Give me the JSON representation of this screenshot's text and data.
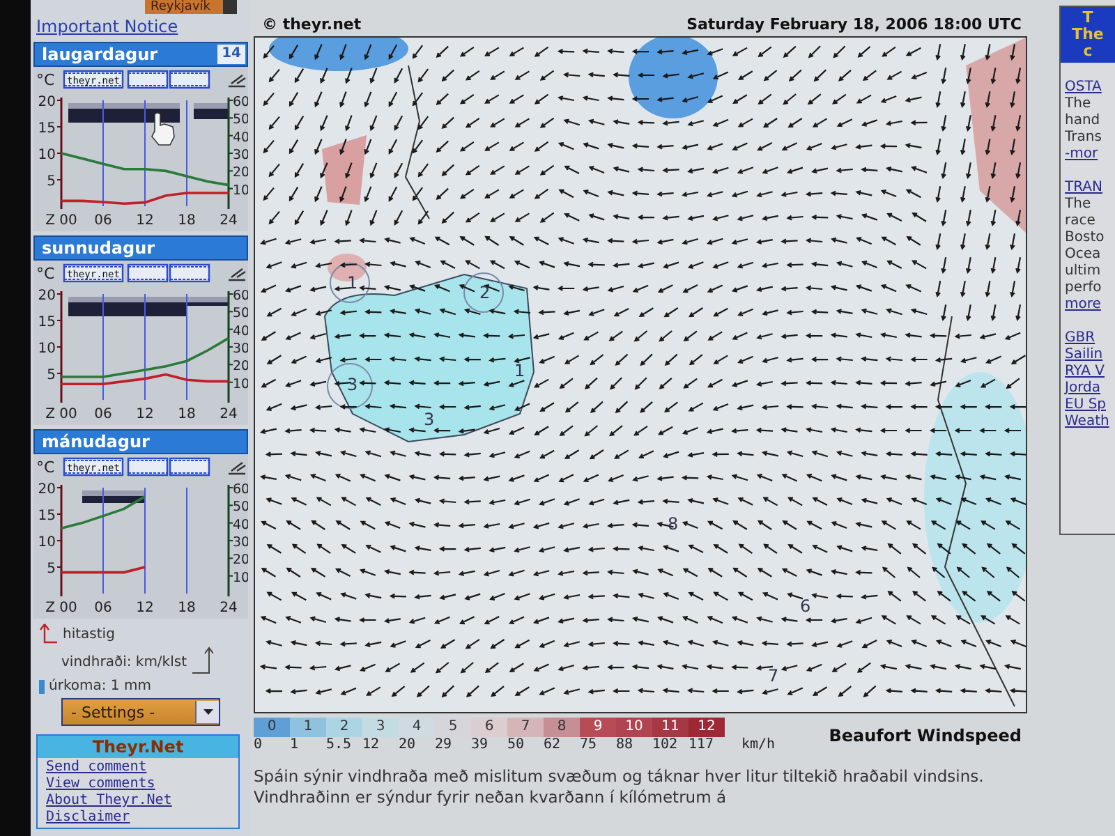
{
  "city_select": {
    "value": "Reykjavík"
  },
  "notice_link": "Important Notice",
  "days": [
    {
      "name": "laugardagur",
      "badge": "14",
      "unit": "°C",
      "logo_text": "theyr.net",
      "chart_data": {
        "type": "line",
        "grid": true,
        "x": [
          0,
          3,
          6,
          9,
          12,
          15,
          18,
          21,
          24
        ],
        "xlim": [
          0,
          24
        ],
        "xticks": [
          {
            "value": 0,
            "label": "Z 00"
          },
          {
            "value": 6,
            "label": "06"
          },
          {
            "value": 12,
            "label": "12"
          },
          {
            "value": 18,
            "label": "18"
          },
          {
            "value": 24,
            "label": "24"
          }
        ],
        "ylim": [
          0,
          20
        ],
        "yticks": [
          5,
          10,
          15,
          20
        ],
        "y2lim": [
          0,
          60
        ],
        "y2ticks": [
          10,
          20,
          30,
          40,
          50,
          60
        ],
        "series": [
          {
            "color": "#c0202a",
            "values": [
              1,
              1,
              0.8,
              0.5,
              0.7,
              2,
              2.5,
              2.5,
              2.5
            ]
          },
          {
            "color": "#2a7a3a",
            "axis": "y2",
            "values": [
              30,
              27,
              24,
              21,
              21,
              20,
              17,
              14,
              12
            ]
          }
        ]
      }
    },
    {
      "name": "sunnudagur",
      "unit": "°C",
      "logo_text": "theyr.net",
      "chart_data": {
        "type": "line",
        "grid": true,
        "x": [
          0,
          3,
          6,
          9,
          12,
          15,
          18,
          21,
          24
        ],
        "xlim": [
          0,
          24
        ],
        "xticks": [
          {
            "value": 0,
            "label": "Z 00"
          },
          {
            "value": 6,
            "label": "06"
          },
          {
            "value": 12,
            "label": "12"
          },
          {
            "value": 18,
            "label": "18"
          },
          {
            "value": 24,
            "label": "24"
          }
        ],
        "ylim": [
          0,
          20
        ],
        "yticks": [
          5,
          10,
          15,
          20
        ],
        "y2lim": [
          0,
          60
        ],
        "y2ticks": [
          10,
          20,
          30,
          40,
          50,
          60
        ],
        "series": [
          {
            "color": "#c0202a",
            "values": [
              3,
              3,
              3,
              3.5,
              4,
              4.8,
              3.8,
              3.5,
              3.5
            ]
          },
          {
            "color": "#2a7a3a",
            "axis": "y2",
            "values": [
              13,
              13,
              13,
              15,
              17,
              19,
              22,
              28,
              35
            ]
          }
        ]
      }
    },
    {
      "name": "mánudagur",
      "unit": "°C",
      "logo_text": "theyr.net",
      "chart_data": {
        "type": "line",
        "grid": true,
        "x": [
          0,
          3,
          6,
          9,
          12
        ],
        "xlim": [
          0,
          24
        ],
        "xticks": [
          {
            "value": 0,
            "label": "Z 00"
          },
          {
            "value": 6,
            "label": "06"
          },
          {
            "value": 12,
            "label": "12"
          },
          {
            "value": 18,
            "label": "18"
          },
          {
            "value": 24,
            "label": "24"
          }
        ],
        "ylim": [
          0,
          20
        ],
        "yticks": [
          5,
          10,
          15,
          20
        ],
        "y2lim": [
          0,
          60
        ],
        "y2ticks": [
          10,
          20,
          30,
          40,
          50,
          60
        ],
        "series": [
          {
            "color": "#c0202a",
            "values": [
              4,
              4,
              4,
              4,
              5
            ]
          },
          {
            "color": "#2a7a3a",
            "axis": "y2",
            "values": [
              37,
              40,
              44,
              48,
              55
            ]
          }
        ]
      }
    }
  ],
  "legend": {
    "temperature": "hitastig",
    "wind": "vindhraði: km/klst",
    "rain": "úrkoma: 1 mm"
  },
  "settings": {
    "value": "- Settings -"
  },
  "links_box": {
    "title": "Theyr.Net",
    "links": [
      "Send comment",
      "View comments",
      "About Theyr.Net",
      "Disclaimer"
    ]
  },
  "map": {
    "credit": "© theyr.net",
    "timestamp": "Saturday February 18, 2006 18:00 UTC",
    "contour_labels": [
      "1",
      "2",
      "1",
      "3",
      "3",
      "8",
      "6",
      "7"
    ]
  },
  "scale": {
    "levels": [
      {
        "label": "0",
        "color": "#5f9fd6"
      },
      {
        "label": "1",
        "color": "#8ec2df"
      },
      {
        "label": "2",
        "color": "#acd5e4"
      },
      {
        "label": "3",
        "color": "#c2dce2"
      },
      {
        "label": "4",
        "color": "#cfdbe0"
      },
      {
        "label": "5",
        "color": "#d6d6da"
      },
      {
        "label": "6",
        "color": "#dccdd1"
      },
      {
        "label": "7",
        "color": "#d6b5b9"
      },
      {
        "label": "8",
        "color": "#c68f95"
      },
      {
        "label": "9",
        "color": "#b84c56"
      },
      {
        "label": "10",
        "color": "#b04450"
      },
      {
        "label": "11",
        "color": "#a63844"
      },
      {
        "label": "12",
        "color": "#9e2836"
      }
    ],
    "speeds": [
      "0",
      "1",
      "5.5",
      "12",
      "20",
      "29",
      "39",
      "50",
      "62",
      "75",
      "88",
      "102",
      "117"
    ],
    "unit": "km/h",
    "title": "Beaufort Windspeed"
  },
  "description": "Spáin sýnir vindhraða með mislitum svæðum og táknar hver litur tiltekið hraðabil vindsins.  Vindhraðinn er sýndur fyrir neðan kvarðann í kílómetrum á",
  "right_column": {
    "header_lines": [
      "T",
      "The",
      "c"
    ],
    "stories": [
      {
        "title": "OSTA",
        "lines": [
          "The",
          "hand",
          "Trans"
        ],
        "more": "-mor"
      },
      {
        "title": "TRAN",
        "lines": [
          "The",
          "race",
          "Bosto",
          "Ocea",
          "ultim",
          "perfo"
        ],
        "more": "more"
      }
    ],
    "links": [
      "GBR",
      "Sailin",
      "RYA V",
      "Jorda",
      "EU Sp",
      "Weath"
    ]
  }
}
